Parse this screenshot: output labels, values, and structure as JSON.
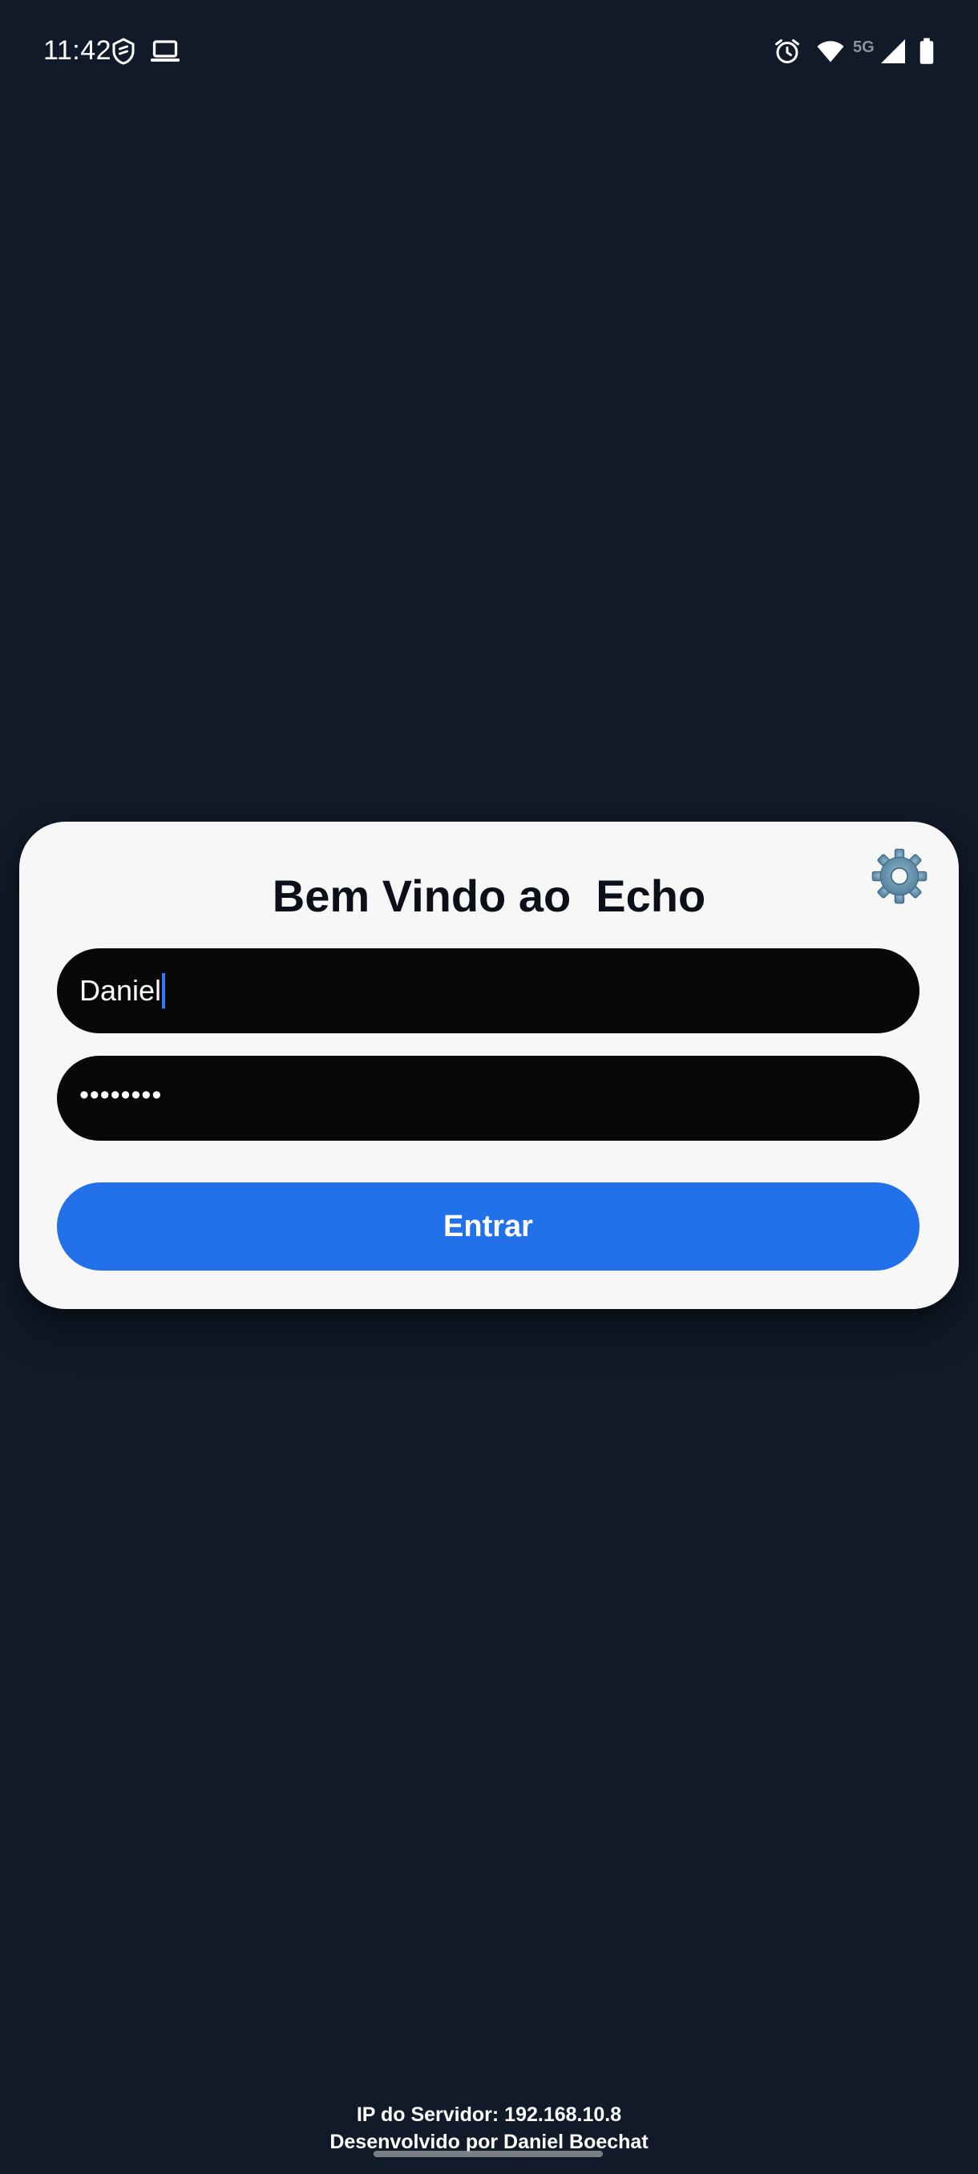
{
  "status_bar": {
    "time": "11:42",
    "network_label": "5G",
    "icons": [
      "shield-sync-icon",
      "laptop-icon",
      "alarm-icon",
      "wifi-icon",
      "signal-icon",
      "battery-icon"
    ]
  },
  "login_card": {
    "title": "Bem Vindo ao  Echo",
    "settings_icon": "gear-icon",
    "username": {
      "value": "Daniel"
    },
    "password": {
      "masked_value": "••••••••"
    },
    "submit_label": "Entrar"
  },
  "footer": {
    "server_ip": "IP do Servidor: 192.168.10.8",
    "developer": "Desenvolvido por Daniel Boechat"
  },
  "colors": {
    "background": "#101a28",
    "card": "#f7f7f7",
    "field": "#080808",
    "accent": "#2271ea",
    "caret": "#2f7bff"
  }
}
